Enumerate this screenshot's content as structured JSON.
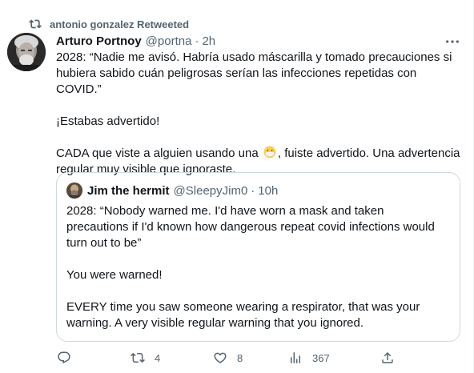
{
  "retweet": {
    "icon": "retweet-icon",
    "label": "antonio gonzalez Retweeted"
  },
  "tweet": {
    "author_name": "Arturo Portnoy",
    "author_handle": "@portna",
    "separator": "·",
    "time": "2h",
    "more_icon": "more-icon",
    "text": {
      "p1": "2028: “Nadie me avisó. Habría usado máscarilla y tomado precauciones si hubiera sabido cuán peligrosas serían las infecciones repetidas con COVID.”",
      "p2": "¡Estabas advertido!",
      "p3_before": "CADA que viste a alguien usando una",
      "p3_emoji": "mask-emoji",
      "p3_after": ", fuiste advertido. Una advertencia regular muy visible que ignoraste."
    }
  },
  "quote": {
    "author_name": "Jim the hermit",
    "author_handle": "@SleepyJim0",
    "separator": "·",
    "time": "10h",
    "text": {
      "p1": "2028: “Nobody warned me. I'd have worn a mask and taken precautions if I'd known how dangerous repeat covid infections would turn out to be”",
      "p2": "You were warned!",
      "p3": "EVERY time you saw someone wearing a respirator, that was your warning. A very visible regular warning that you ignored."
    }
  },
  "actions": {
    "reply_icon": "reply-icon",
    "reply_count": "",
    "retweet_icon": "retweet-icon",
    "retweet_count": "4",
    "like_icon": "heart-icon",
    "like_count": "8",
    "views_icon": "views-icon",
    "views_count": "367",
    "share_icon": "share-icon"
  },
  "colors": {
    "text": "#0f1419",
    "secondary": "#536471",
    "border": "#cfd9de"
  }
}
